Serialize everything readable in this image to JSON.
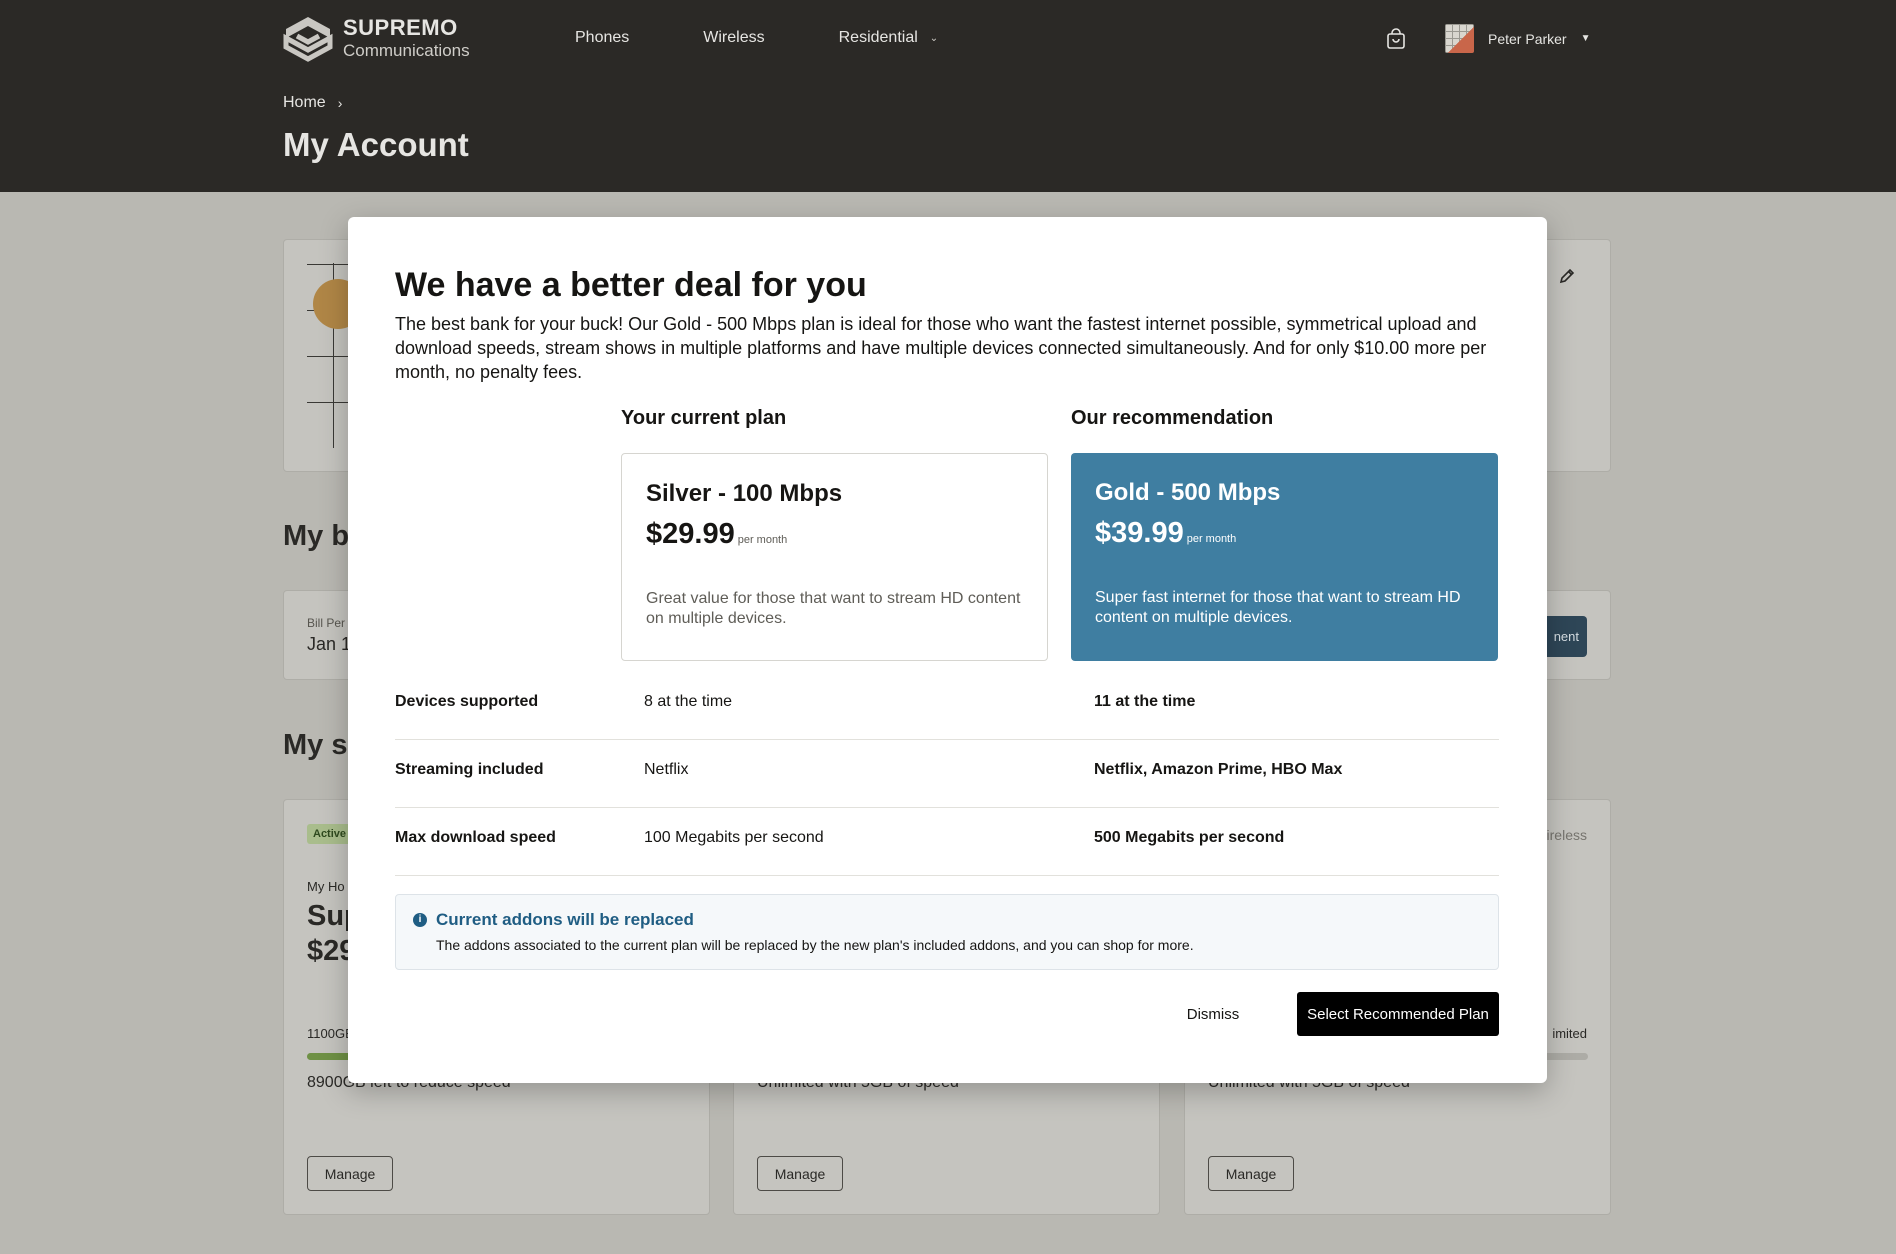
{
  "brand": {
    "name": "SUPREMO",
    "sub": "Communications"
  },
  "nav": [
    {
      "label": "Phones"
    },
    {
      "label": "Wireless"
    },
    {
      "label": "Residential"
    }
  ],
  "user": {
    "name": "Peter Parker"
  },
  "breadcrumb": {
    "home": "Home"
  },
  "page": {
    "title": "My Account"
  },
  "background": {
    "billing_heading": "My b",
    "bill_label": "Bill Per",
    "bill_date": "Jan 1",
    "pay_button": "nent",
    "services_heading": "My s",
    "services": [
      {
        "badge": "Active",
        "subtitle": "My Ho",
        "name": "Sup",
        "price": "$29",
        "usage": "1100GB",
        "usage_fraction": 0.12,
        "note": "8900GB left to reduce speed",
        "manage": "Manage"
      },
      {
        "note": "Unlimited with 5GB of speed",
        "manage": "Manage"
      },
      {
        "category": "ireless",
        "usage": "imited",
        "note": "Unlimited with 5GB of speed",
        "manage": "Manage"
      }
    ]
  },
  "modal": {
    "title": "We have a better deal for you",
    "description": "The best bank for your buck! Our Gold - 500 Mbps plan is ideal for those who want the fastest internet possible,  symmetrical upload and download speeds, stream shows in multiple platforms and have multiple devices connected simultaneously. And for only $10.00 more per month, no penalty fees.",
    "current_heading": "Your current plan",
    "recommended_heading": "Our recommendation",
    "current_plan": {
      "name": "Silver - 100 Mbps",
      "price": "$29.99",
      "period": "per month",
      "blurb": "Great value for those that want to stream HD content on multiple devices."
    },
    "recommended_plan": {
      "name": "Gold - 500 Mbps",
      "price": "$39.99",
      "period": "per month",
      "blurb": "Super fast internet for those that want to stream HD content on multiple devices."
    },
    "comparison": [
      {
        "label": "Devices supported",
        "current": "8 at the time",
        "recommended": "11 at the time"
      },
      {
        "label": "Streaming included",
        "current": "Netflix",
        "recommended": "Netflix, Amazon Prime, HBO Max"
      },
      {
        "label": "Max download speed",
        "current": "100 Megabits per second",
        "recommended": "500 Megabits per second"
      }
    ],
    "notice": {
      "title": "Current addons will be replaced",
      "text": "The addons associated to the current plan will be replaced by the new plan's included addons, and you can shop for more."
    },
    "dismiss_label": "Dismiss",
    "select_label": "Select Recommended Plan"
  },
  "colors": {
    "header_bg": "#2b2926",
    "accent_blue": "#3f7ea1",
    "notice_blue": "#1f5d83",
    "active_green": "#6f9145"
  }
}
